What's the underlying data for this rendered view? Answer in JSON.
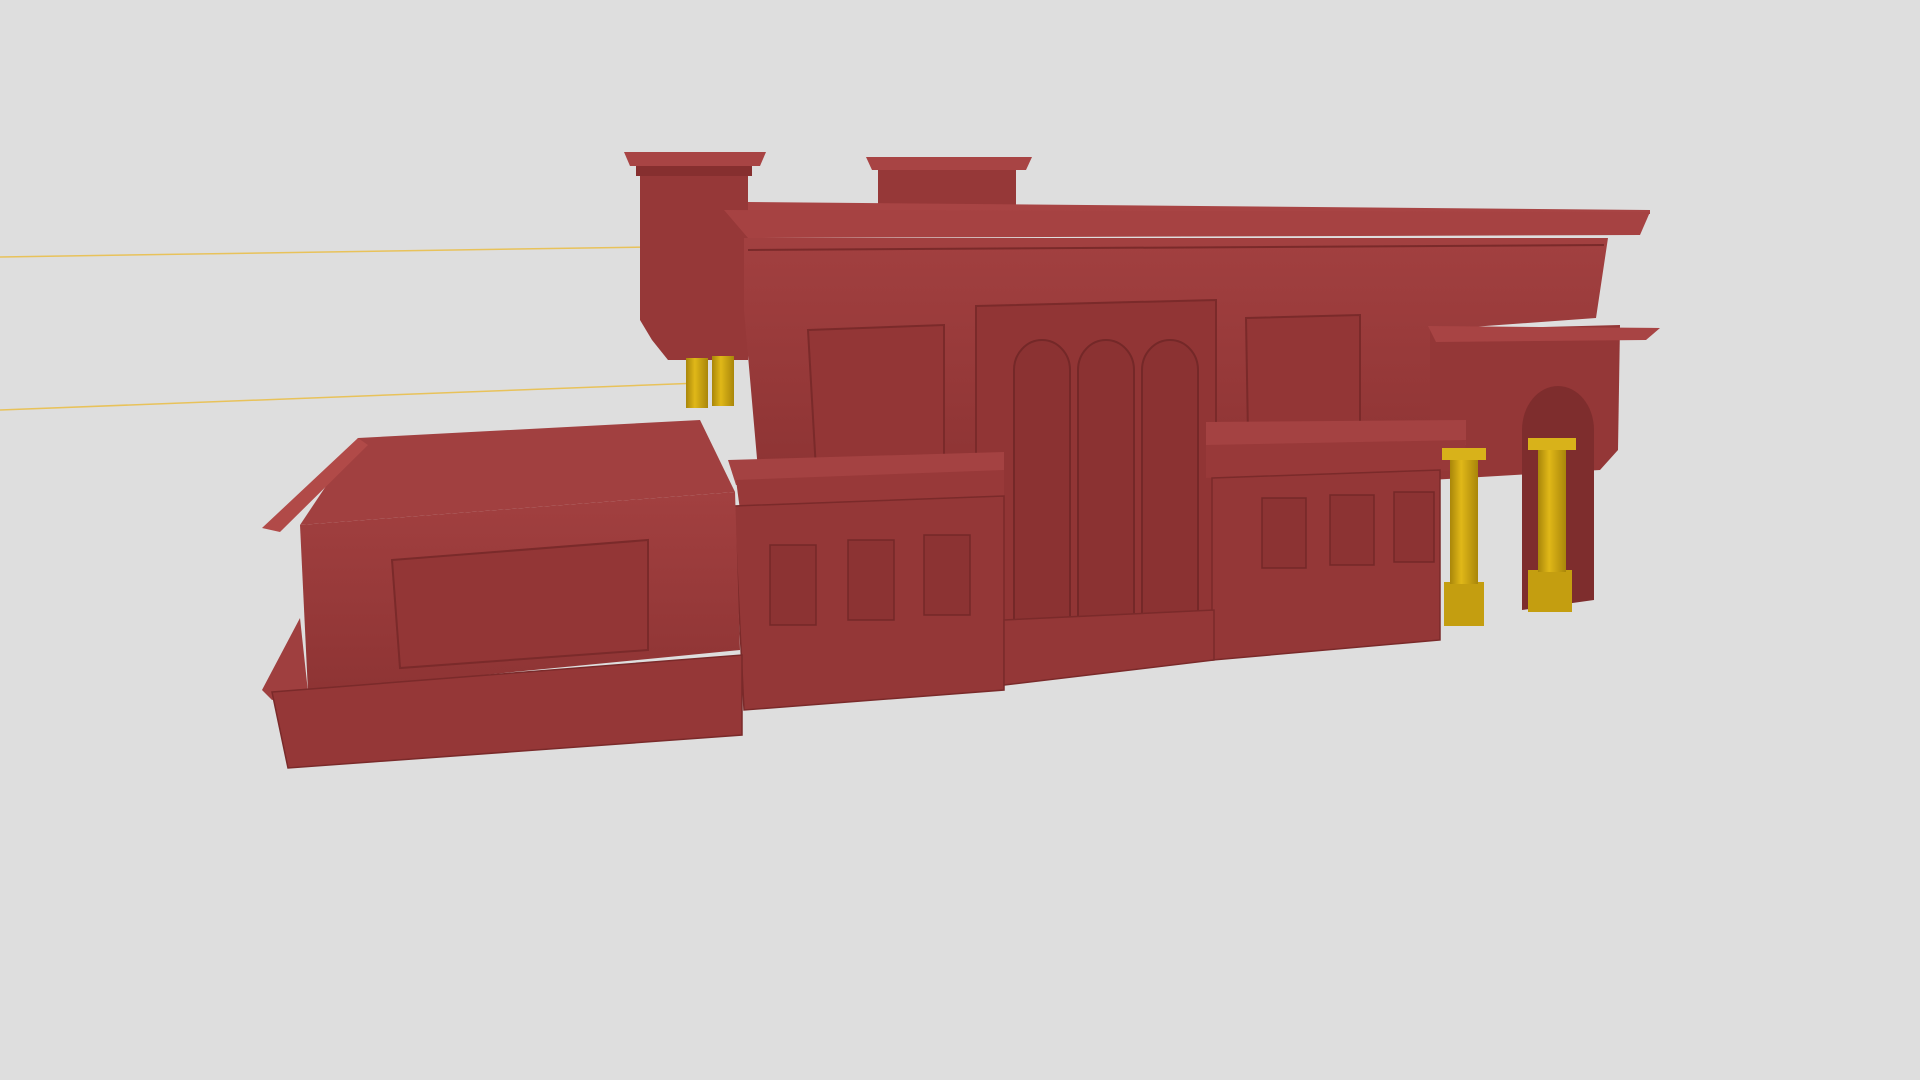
{
  "viewport": {
    "background_color": "#dedede",
    "description_of_visible_text": ""
  },
  "model": {
    "wall_color": "#9a3a3a",
    "wall_shadow_color": "#7c2c2c",
    "wall_highlight_color": "#b04a48",
    "column_color": "#d1aa12",
    "column_shadow_color": "#a9860a",
    "guide_line_color": "#e8c25a"
  }
}
